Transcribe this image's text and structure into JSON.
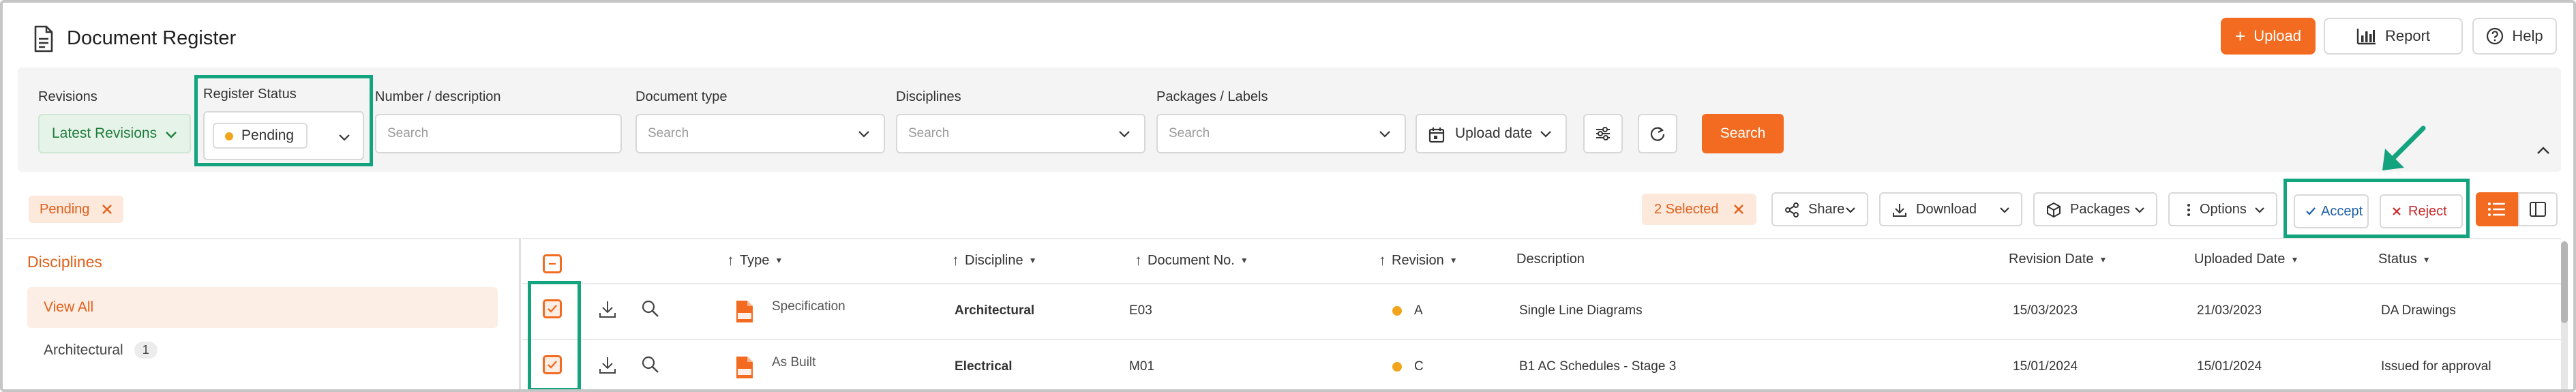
{
  "header": {
    "title": "Document Register",
    "upload_label": "Upload",
    "report_label": "Report",
    "help_label": "Help"
  },
  "filters": {
    "revisions_label": "Revisions",
    "revisions_value": "Latest Revisions",
    "register_status_label": "Register Status",
    "register_status_value": "Pending",
    "number_label": "Number / description",
    "number_placeholder": "Search",
    "doctype_label": "Document type",
    "doctype_placeholder": "Search",
    "disciplines_label": "Disciplines",
    "disciplines_placeholder": "Search",
    "packages_label": "Packages / Labels",
    "packages_placeholder": "Search",
    "upload_date_label": "Upload date",
    "search_button": "Search"
  },
  "toolbar": {
    "active_filter": "Pending",
    "selected_label": "2 Selected",
    "share": "Share",
    "download": "Download",
    "packages": "Packages",
    "options": "Options",
    "accept": "Accept",
    "reject": "Reject"
  },
  "sidebar": {
    "title": "Disciplines",
    "items": [
      {
        "label": "View All"
      },
      {
        "label": "Architectural",
        "count": "1"
      }
    ]
  },
  "table": {
    "columns": [
      "Type",
      "Discipline",
      "Document No.",
      "Revision",
      "Description",
      "Revision Date",
      "Uploaded Date",
      "Status"
    ],
    "rows": [
      {
        "type": "Specification",
        "discipline": "Architectural",
        "doc_no": "E03",
        "revision": "A",
        "description": "Single Line Diagrams",
        "revision_date": "15/03/2023",
        "uploaded_date": "21/03/2023",
        "status": "DA Drawings"
      },
      {
        "type": "As Built",
        "discipline": "Electrical",
        "doc_no": "M01",
        "revision": "C",
        "description": "B1 AC Schedules - Stage 3",
        "revision_date": "15/01/2024",
        "uploaded_date": "15/01/2024",
        "status": "Issued for approval"
      }
    ]
  },
  "colors": {
    "accent": "#f26b21",
    "highlight": "#14a37f",
    "pending_dot": "#f2a51a"
  }
}
